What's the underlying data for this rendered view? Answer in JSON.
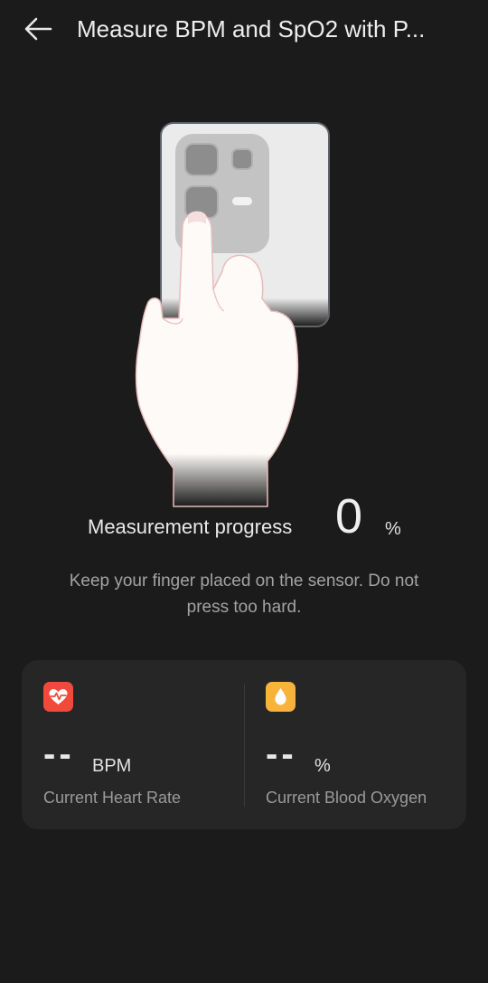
{
  "header": {
    "title": "Measure BPM and SpO2 with P...",
    "back_icon": "arrow-left-icon"
  },
  "progress": {
    "label": "Measurement progress",
    "value": "0",
    "unit": "%"
  },
  "hint": "Keep your finger placed on the sensor. Do not press too hard.",
  "metrics": {
    "heart_rate": {
      "icon": "heart-pulse-icon",
      "value": "--",
      "unit": "BPM",
      "label": "Current Heart Rate",
      "color": "#f24a3a"
    },
    "blood_oxygen": {
      "icon": "water-drop-icon",
      "value": "--",
      "unit": "%",
      "label": "Current Blood Oxygen",
      "color": "#f9b23a"
    }
  }
}
